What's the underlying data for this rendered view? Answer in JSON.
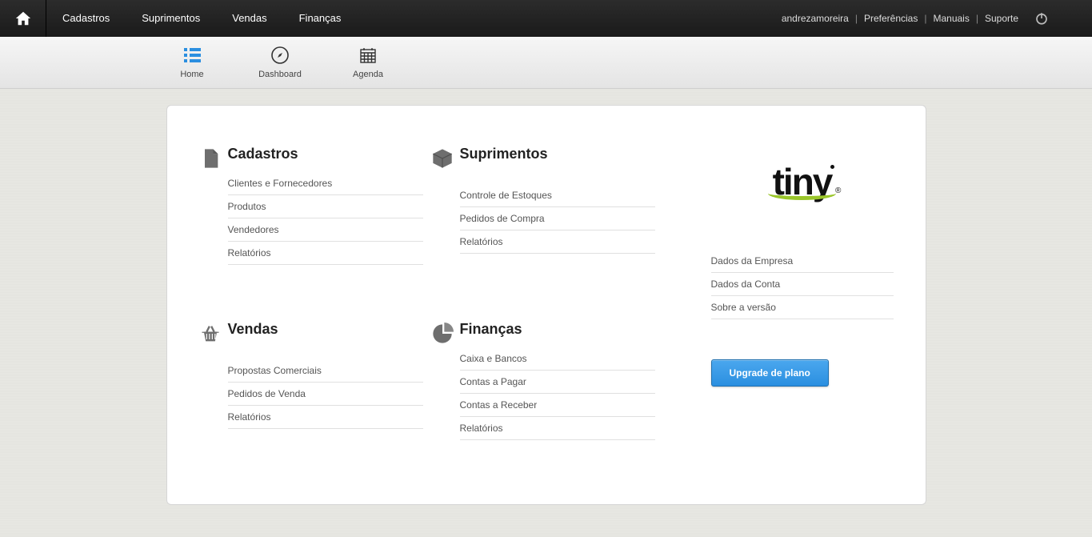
{
  "topnav": {
    "main": [
      "Cadastros",
      "Suprimentos",
      "Vendas",
      "Finanças"
    ],
    "user": "andrezamoreira",
    "right": [
      "Preferências",
      "Manuais",
      "Suporte"
    ]
  },
  "toolbar": {
    "items": [
      {
        "label": "Home"
      },
      {
        "label": "Dashboard"
      },
      {
        "label": "Agenda"
      }
    ]
  },
  "blocks": {
    "cadastros": {
      "title": "Cadastros",
      "links": [
        "Clientes e Fornecedores",
        "Produtos",
        "Vendedores",
        "Relatórios"
      ]
    },
    "suprimentos": {
      "title": "Suprimentos",
      "links": [
        "Controle de Estoques",
        "Pedidos de Compra",
        "Relatórios"
      ]
    },
    "vendas": {
      "title": "Vendas",
      "links": [
        "Propostas Comerciais",
        "Pedidos de Venda",
        "Relatórios"
      ]
    },
    "financas": {
      "title": "Finanças",
      "links": [
        "Caixa e Bancos",
        "Contas a Pagar",
        "Contas a Receber",
        "Relatórios"
      ]
    }
  },
  "right": {
    "logo_text": "tiny",
    "links": [
      "Dados da Empresa",
      "Dados da Conta",
      "Sobre a versão"
    ],
    "upgrade_label": "Upgrade de plano"
  }
}
